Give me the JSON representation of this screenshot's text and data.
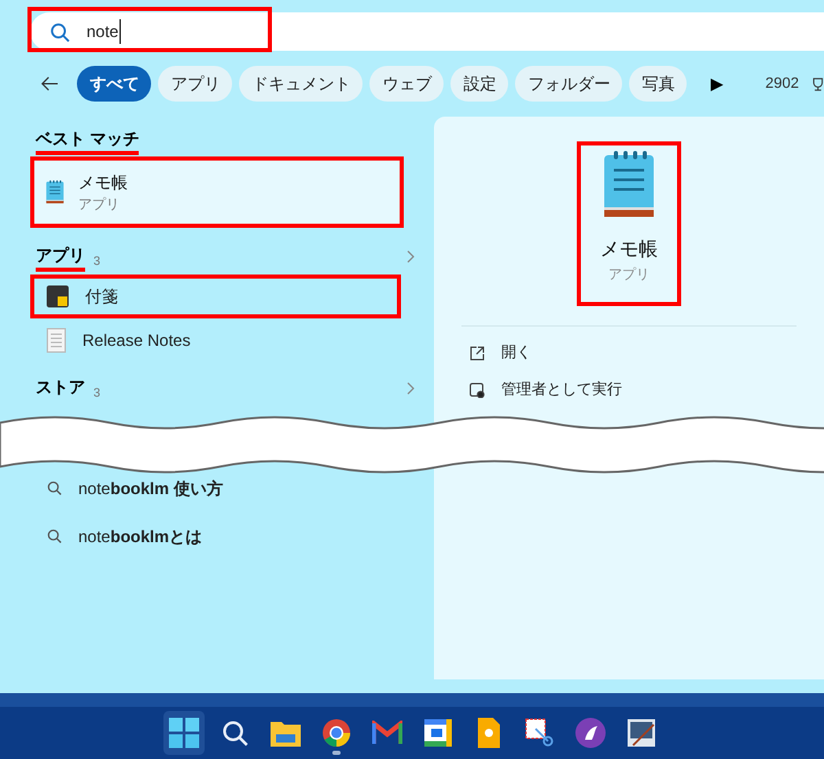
{
  "search": {
    "value": "note",
    "marked": true
  },
  "filters": [
    {
      "label": "すべて",
      "selected": true
    },
    {
      "label": "アプリ",
      "selected": false
    },
    {
      "label": "ドキュメント",
      "selected": false
    },
    {
      "label": "ウェブ",
      "selected": false
    },
    {
      "label": "設定",
      "selected": false
    },
    {
      "label": "フォルダー",
      "selected": false
    },
    {
      "label": "写真",
      "selected": false
    }
  ],
  "more_button": "▶",
  "points": "2902",
  "best_match": {
    "heading": "ベスト マッチ",
    "underlined": true,
    "item": {
      "title": "メモ帳",
      "subtitle": "アプリ",
      "marked": true
    }
  },
  "sections": [
    {
      "heading": "アプリ",
      "count": "3",
      "underlined": true,
      "items": [
        {
          "kind": "sticky",
          "title": "付箋",
          "marked": true
        },
        {
          "kind": "document",
          "title": "Release Notes",
          "marked": false
        }
      ]
    },
    {
      "heading": "ストア",
      "count": "3",
      "underlined": false
    }
  ],
  "suggestions": [
    {
      "text": "note**booklm 使い方**"
    },
    {
      "text": "note**booklmとは**"
    }
  ],
  "preview": {
    "title": "メモ帳",
    "subtitle": "アプリ",
    "marked": true,
    "actions": [
      {
        "kind": "open",
        "label": "開く"
      },
      {
        "kind": "admin",
        "label": "管理者として実行"
      }
    ]
  },
  "taskbar": [
    {
      "kind": "start",
      "selected": true,
      "running": false
    },
    {
      "kind": "search",
      "selected": false,
      "running": false
    },
    {
      "kind": "folder",
      "selected": false,
      "running": false
    },
    {
      "kind": "browser",
      "selected": false,
      "running": true
    },
    {
      "kind": "mail",
      "selected": false,
      "running": false
    },
    {
      "kind": "calendar",
      "selected": false,
      "running": false
    },
    {
      "kind": "note",
      "selected": false,
      "running": false
    },
    {
      "kind": "snip",
      "selected": false,
      "running": false
    },
    {
      "kind": "purple",
      "selected": false,
      "running": false
    },
    {
      "kind": "screen",
      "selected": false,
      "running": false
    }
  ]
}
